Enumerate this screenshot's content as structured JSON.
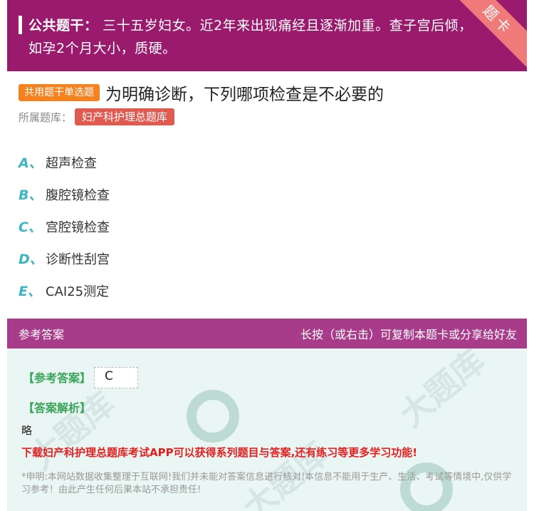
{
  "stem": {
    "label": "公共题干：",
    "text": "三十五岁妇女。近2年来出现痛经且逐渐加重。查子宫后倾，如孕2个月大小，质硬。",
    "ribbon": "题卡"
  },
  "question": {
    "type_tag": "共用题干单选题",
    "title": "为明确诊断，下列哪项检查是不必要的",
    "category_label": "所属题库：",
    "category": "妇产科护理总题库"
  },
  "options": [
    {
      "letter": "A、",
      "text": "超声检查"
    },
    {
      "letter": "B、",
      "text": "腹腔镜检查"
    },
    {
      "letter": "C、",
      "text": "宫腔镜检查"
    },
    {
      "letter": "D、",
      "text": "诊断性刮宫"
    },
    {
      "letter": "E、",
      "text": "CAI25测定"
    }
  ],
  "answer": {
    "header_left": "参考答案",
    "header_right": "长按（或右击）可复制本题卡或分享给好友",
    "ref_label": "【参考答案】",
    "ref_value": "C",
    "exp_label": "【答案解析】",
    "exp_text": "略",
    "promo": "下载妇产科护理总题库考试APP可以获得系列题目与答案,还有练习等更多学习功能!",
    "disclaimer": "*申明:本网站数据收集整理于互联网!我们并未能对答案信息进行核对!本信息不能用于生产、生活、考试等情境中,仅供学习参考！由此产生任何后果本站不承担责任!"
  },
  "colors": {
    "stem_bg": "#9a1a6e",
    "answer_header_bg": "#a83b8a",
    "type_tag_bg": "#f5821f",
    "category_bg": "#e05a4f",
    "option_letter": "#3ab7c3",
    "answer_body_bg": "#e9f6f3",
    "promo_text": "#e61e1e"
  }
}
